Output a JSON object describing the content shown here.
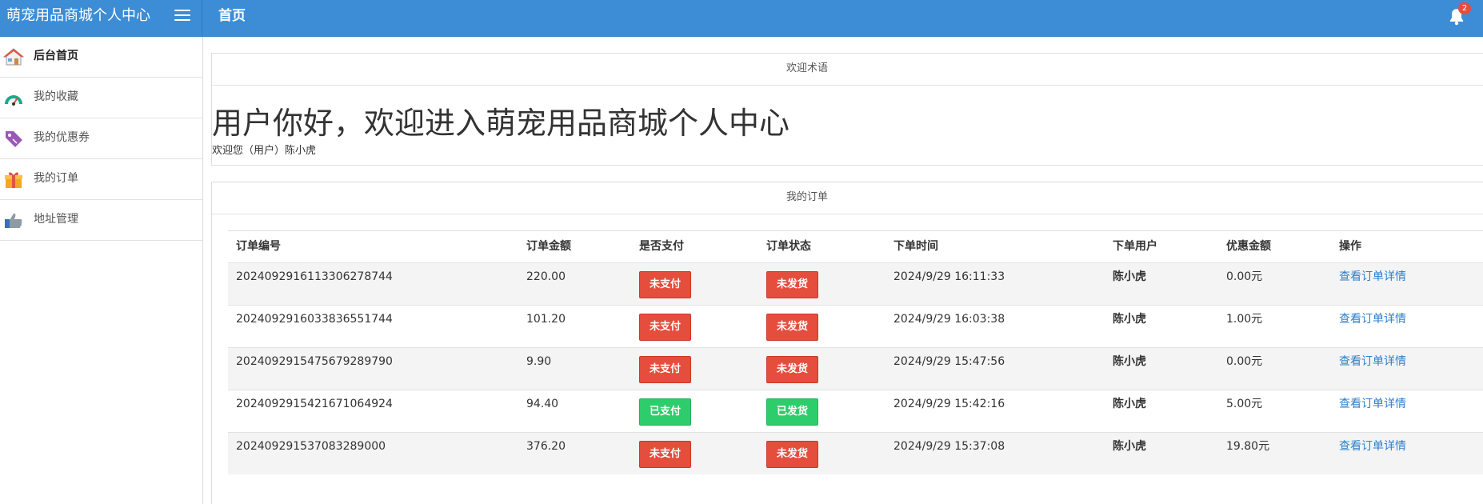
{
  "header": {
    "brand": "萌宠用品商城个人中心",
    "title": "首页",
    "notification_count": "2"
  },
  "sidebar": {
    "items": [
      {
        "label": "后台首页",
        "icon": "house-icon",
        "active": true
      },
      {
        "label": "我的收藏",
        "icon": "gauge-icon",
        "active": false
      },
      {
        "label": "我的优惠券",
        "icon": "tag-icon",
        "active": false
      },
      {
        "label": "我的订单",
        "icon": "gift-icon",
        "active": false
      },
      {
        "label": "地址管理",
        "icon": "thumbs-up-icon",
        "active": false
      }
    ]
  },
  "welcome": {
    "panel_title": "欢迎术语",
    "headline": "用户你好，欢迎进入萌宠用品商城个人中心",
    "subtitle": "欢迎您（用户）陈小虎"
  },
  "orders": {
    "panel_title": "我的订单",
    "columns": [
      "订单编号",
      "订单金额",
      "是否支付",
      "订单状态",
      "下单时间",
      "下单用户",
      "优惠金额",
      "操作"
    ],
    "rows": [
      {
        "id": "202409291611330627874​4",
        "amount": "220.00",
        "paid": "未支付",
        "paid_ok": false,
        "status": "未发货",
        "status_ok": false,
        "time": "2024/9/29 16:11:33",
        "user": "陈小虎",
        "discount": "0.00元",
        "action": "查看订单详情"
      },
      {
        "id": "2024092916033836551744",
        "amount": "101.20",
        "paid": "未支付",
        "paid_ok": false,
        "status": "未发货",
        "status_ok": false,
        "time": "2024/9/29 16:03:38",
        "user": "陈小虎",
        "discount": "1.00元",
        "action": "查看订单详情"
      },
      {
        "id": "2024092915475679289790",
        "amount": "9.90",
        "paid": "未支付",
        "paid_ok": false,
        "status": "未发货",
        "status_ok": false,
        "time": "2024/9/29 15:47:56",
        "user": "陈小虎",
        "discount": "0.00元",
        "action": "查看订单详情"
      },
      {
        "id": "2024092915421671064924",
        "amount": "94.40",
        "paid": "已支付",
        "paid_ok": true,
        "status": "已发货",
        "status_ok": true,
        "time": "2024/9/29 15:42:16",
        "user": "陈小虎",
        "discount": "5.00元",
        "action": "查看订单详情"
      },
      {
        "id": "2024092915370832890​00",
        "amount": "376.20",
        "paid": "未支付",
        "paid_ok": false,
        "status": "未发货",
        "status_ok": false,
        "time": "2024/9/29 15:37:08",
        "user": "陈小虎",
        "discount": "19.80元",
        "action": "查看订单详情"
      }
    ]
  },
  "colors": {
    "topbar": "#3c8dd6",
    "danger": "#e54d3c",
    "success": "#2dcd6b",
    "link": "#2d7fcb"
  }
}
